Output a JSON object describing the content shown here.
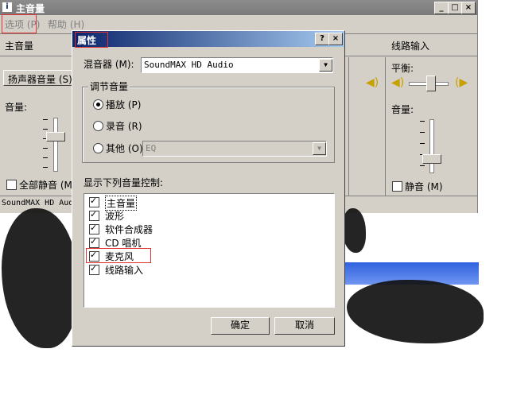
{
  "main_window": {
    "title": "主音量",
    "menu": {
      "options": "选项 (P)",
      "help": "帮助 (H)"
    },
    "master_label": "主音量",
    "speaker_volume_button": "扬声器音量 (S)",
    "volume_label": "音量:",
    "mute_all": {
      "label": "全部静音 (M)",
      "checked": false
    },
    "status_text": "SoundMAX HD Audio",
    "line_in": {
      "title": "线路输入",
      "balance_label": "平衡:",
      "volume_label": "音量:",
      "mute": {
        "label": "静音 (M)",
        "checked": false
      }
    }
  },
  "dialog": {
    "title": "属性",
    "help_button": "?",
    "close_button": "×",
    "mixer_label": "混音器 (M):",
    "mixer_value": "SoundMAX HD Audio",
    "adjust_group_label": "调节音量",
    "radio_playback": "播放 (P)",
    "radio_record": "录音 (R)",
    "radio_other": "其他 (O)",
    "other_value": "EQ",
    "selected_mode": "playback",
    "show_controls_label": "显示下列音量控制:",
    "controls": [
      {
        "label": "主音量",
        "checked": true
      },
      {
        "label": "波形",
        "checked": true
      },
      {
        "label": "软件合成器",
        "checked": true
      },
      {
        "label": "CD 唱机",
        "checked": true
      },
      {
        "label": "麦克风",
        "checked": true
      },
      {
        "label": "线路输入",
        "checked": true
      }
    ],
    "ok_button": "确定",
    "cancel_button": "取消"
  },
  "colors": {
    "highlight_box": "#e03030",
    "dialog_title": "#0a246a",
    "window_bg": "#d4d0c8",
    "behind_bar": "#3a6ee8"
  }
}
